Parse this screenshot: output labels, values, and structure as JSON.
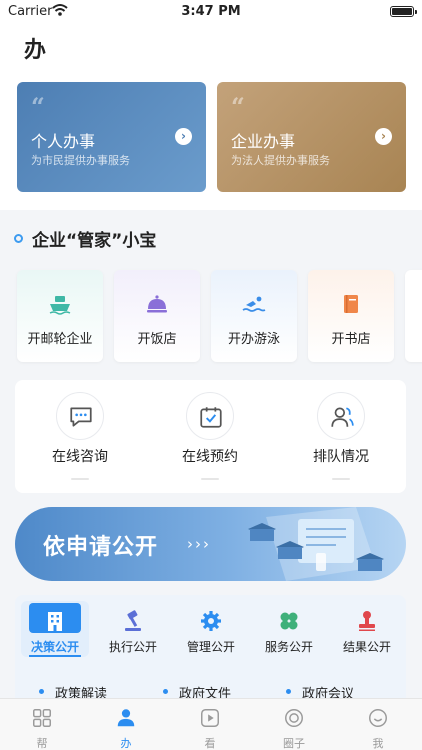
{
  "status_bar": {
    "carrier": "Carrier",
    "time": "3:47 PM"
  },
  "page_title": "办",
  "service_cards": [
    {
      "quote": "“",
      "title": "个人办事",
      "subtitle": "为市民提供办事服务",
      "arrow": "›"
    },
    {
      "quote": "“",
      "title": "企业办事",
      "subtitle": "为法人提供办事服务",
      "arrow": "›"
    }
  ],
  "section": {
    "title": "企业“管家”小宝"
  },
  "tiles": [
    {
      "label": "开邮轮企业",
      "icon": "cruise-ship-icon",
      "color": "#3fb8a6"
    },
    {
      "label": "开饭店",
      "icon": "food-cloche-icon",
      "color": "#8a6fd8"
    },
    {
      "label": "开办游泳",
      "icon": "swimmer-icon",
      "color": "#3a8de8"
    },
    {
      "label": "开书店",
      "icon": "book-icon",
      "color": "#f0874a"
    }
  ],
  "consult": [
    {
      "label": "在线咨询",
      "icon": "chat-bubble-icon"
    },
    {
      "label": "在线预约",
      "icon": "calendar-check-icon"
    },
    {
      "label": "排队情况",
      "icon": "users-icon"
    }
  ],
  "banner": {
    "text": "依申请公开",
    "chevrons": "›››"
  },
  "policy_tabs": [
    {
      "label": "决策公开",
      "icon": "building-icon",
      "active": true
    },
    {
      "label": "执行公开",
      "icon": "gavel-icon",
      "active": false
    },
    {
      "label": "管理公开",
      "icon": "gear-icon",
      "active": false
    },
    {
      "label": "服务公开",
      "icon": "clover-icon",
      "active": false
    },
    {
      "label": "结果公开",
      "icon": "stamp-icon",
      "active": false
    }
  ],
  "policy_links": [
    "政策解读",
    "政府文件",
    "政府会议"
  ],
  "tabbar": [
    {
      "label": "帮",
      "icon": "grid-icon",
      "active": false
    },
    {
      "label": "办",
      "icon": "person-icon",
      "active": true
    },
    {
      "label": "看",
      "icon": "play-icon",
      "active": false
    },
    {
      "label": "圈子",
      "icon": "target-icon",
      "active": false
    },
    {
      "label": "我",
      "icon": "smile-icon",
      "active": false
    }
  ],
  "colors": {
    "accent": "#2c8df0",
    "personal_card": "#4d7eb3",
    "enterprise_card": "#b08c5e"
  }
}
